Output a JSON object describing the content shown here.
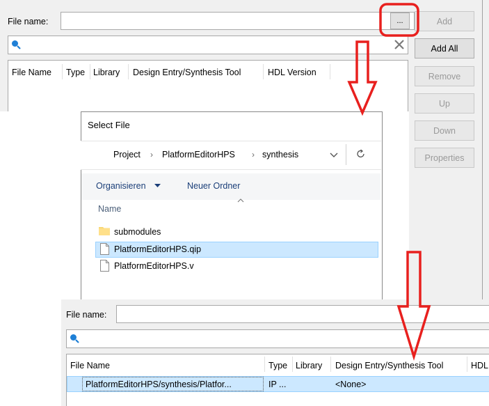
{
  "top": {
    "file_name_label": "File name:",
    "file_name_value": "",
    "browse_label": "...",
    "search_value": "",
    "columns": [
      "File Name",
      "Type",
      "Library",
      "Design Entry/Synthesis Tool",
      "HDL Version"
    ]
  },
  "buttons": {
    "add": "Add",
    "add_all": "Add All",
    "remove": "Remove",
    "up": "Up",
    "down": "Down",
    "properties": "Properties"
  },
  "dialog": {
    "title": "Select File",
    "breadcrumb": [
      "Project",
      "PlatformEditorHPS",
      "synthesis"
    ],
    "organize": "Organisieren",
    "new_folder": "Neuer Ordner",
    "name_column": "Name",
    "files": [
      {
        "name": "submodules",
        "kind": "folder",
        "selected": false
      },
      {
        "name": "PlatformEditorHPS.qip",
        "kind": "file",
        "selected": true
      },
      {
        "name": "PlatformEditorHPS.v",
        "kind": "file",
        "selected": false
      }
    ]
  },
  "bottom": {
    "file_name_label": "File name:",
    "columns": [
      "File Name",
      "Type",
      "Library",
      "Design Entry/Synthesis Tool",
      "HDL"
    ],
    "row": {
      "file_name": "PlatformEditorHPS/synthesis/Platfor...",
      "type": "IP ...",
      "library": "",
      "tool": "<None>",
      "hdl": ""
    }
  },
  "colors": {
    "annotation_red": "#e8201e",
    "selection": "#cce8ff",
    "search_icon": "#1e7fd6"
  },
  "icons": [
    "search-icon",
    "clear-icon",
    "chevron-down-icon",
    "refresh-icon",
    "folder-icon",
    "file-icon",
    "sort-up-icon",
    "arrow-down-icon"
  ]
}
